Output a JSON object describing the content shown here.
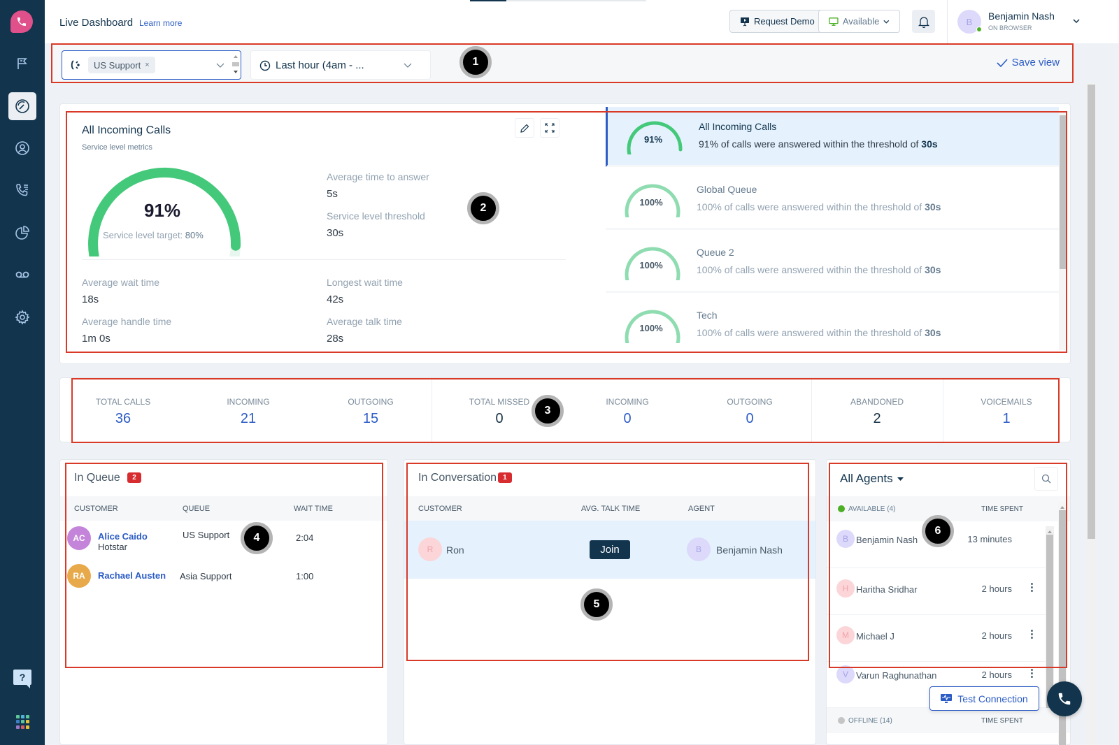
{
  "sidebar": {
    "logo": "phone-logo",
    "items": [
      {
        "name": "flag",
        "icon": "flag-icon",
        "active": false
      },
      {
        "name": "dashboard",
        "icon": "speedometer-icon",
        "active": true
      },
      {
        "name": "contacts",
        "icon": "user-circle-icon",
        "active": false
      },
      {
        "name": "call-log",
        "icon": "phone-list-icon",
        "active": false
      },
      {
        "name": "analytics",
        "icon": "pie-chart-icon",
        "active": false
      },
      {
        "name": "voicemail",
        "icon": "voicemail-icon",
        "active": false
      },
      {
        "name": "settings",
        "icon": "gear-icon",
        "active": false
      }
    ],
    "help_label": "?",
    "apps_colors": [
      "#5fc69a",
      "#4fb3d9",
      "#5fc69a",
      "#3d7fc4",
      "#5fc69a",
      "#e2c23a",
      "#9a7ac6",
      "#d65d64",
      "#e2c23a"
    ]
  },
  "header": {
    "title": "Live Dashboard",
    "learn_more": "Learn more",
    "request_demo": "Request Demo",
    "availability": "Available",
    "user": {
      "initial": "B",
      "name": "Benjamin Nash",
      "status": "ON BROWSER"
    }
  },
  "filters": {
    "queue_chip": "US Support",
    "time_range": "Last hour (4am - ...",
    "save_view": "Save view"
  },
  "markers": [
    "1",
    "2",
    "3",
    "4",
    "5",
    "6"
  ],
  "service_level": {
    "title": "All Incoming Calls",
    "subtitle": "Service level metrics",
    "gauge_value": "91%",
    "gauge_fraction": 0.91,
    "target_label": "Service level target:",
    "target_value": "80%",
    "metrics": [
      {
        "label": "Average time to answer",
        "value": "5s"
      },
      {
        "label": "Service level threshold",
        "value": "30s"
      },
      {
        "label": "Average wait time",
        "value": "18s"
      },
      {
        "label": "Longest wait time",
        "value": "42s"
      },
      {
        "label": "Average handle time",
        "value": "1m 0s"
      },
      {
        "label": "Average talk time",
        "value": "28s"
      }
    ],
    "queues": [
      {
        "name": "All Incoming Calls",
        "percent": "91%",
        "fraction": 0.91,
        "desc_prefix": "91% of calls were answered within the threshold of ",
        "threshold": "30s",
        "active": true
      },
      {
        "name": "Global Queue",
        "percent": "100%",
        "fraction": 1.0,
        "desc_prefix": "100% of calls were answered within the threshold of ",
        "threshold": "30s",
        "active": false
      },
      {
        "name": "Queue 2",
        "percent": "100%",
        "fraction": 1.0,
        "desc_prefix": "100% of calls were answered within the threshold of ",
        "threshold": "30s",
        "active": false
      },
      {
        "name": "Tech",
        "percent": "100%",
        "fraction": 1.0,
        "desc_prefix": "100% of calls were answered within the threshold of ",
        "threshold": "30s",
        "active": false
      }
    ]
  },
  "stats": [
    {
      "label": "TOTAL CALLS",
      "value": "36"
    },
    {
      "label": "INCOMING",
      "value": "21"
    },
    {
      "label": "OUTGOING",
      "value": "15"
    },
    {
      "label": "TOTAL MISSED",
      "value": "0"
    },
    {
      "label": "INCOMING",
      "value": "0"
    },
    {
      "label": "OUTGOING",
      "value": "0"
    },
    {
      "label": "ABANDONED",
      "value": "2"
    },
    {
      "label": "VOICEMAILS",
      "value": "1"
    }
  ],
  "in_queue": {
    "title": "In Queue",
    "count": "2",
    "columns": [
      "CUSTOMER",
      "QUEUE",
      "WAIT TIME"
    ],
    "rows": [
      {
        "initials": "AC",
        "avatar_color": "#c384d9",
        "name": "Alice Caido",
        "company": "Hotstar",
        "queue": "US Support",
        "wait": "2:04"
      },
      {
        "initials": "RA",
        "avatar_color": "#e8a94a",
        "name": "Rachael Austen",
        "company": "",
        "queue": "Asia Support",
        "wait": "1:00"
      }
    ]
  },
  "in_conversation": {
    "title": "In Conversation",
    "count": "1",
    "columns": [
      "CUSTOMER",
      "AVG. TALK TIME",
      "AGENT"
    ],
    "rows": [
      {
        "customer_initial": "R",
        "customer": "Ron",
        "action": "Join",
        "agent_initial": "B",
        "agent": "Benjamin Nash"
      }
    ]
  },
  "agents": {
    "filter_label": "All Agents",
    "available_label": "AVAILABLE (4)",
    "time_header": "TIME SPENT",
    "available": [
      {
        "initial": "B",
        "name": "Benjamin Nash",
        "time": "13 minutes",
        "color": "#dcd9fb",
        "text": "#a8a3e6",
        "menu": false
      },
      {
        "initial": "H",
        "name": "Haritha Sridhar",
        "time": "2 hours",
        "color": "#fbd5d8",
        "text": "#f0a4aa",
        "menu": true
      },
      {
        "initial": "M",
        "name": "Michael J",
        "time": "2 hours",
        "color": "#fbd5d8",
        "text": "#f0a4aa",
        "menu": true
      },
      {
        "initial": "V",
        "name": "Varun Raghunathan",
        "time": "2 hours",
        "color": "#dcd9fb",
        "text": "#a8a3e6",
        "menu": true
      }
    ],
    "offline_label": "OFFLINE (14)",
    "offline_time_header": "TIME SPENT"
  },
  "floating": {
    "test_connection": "Test Connection"
  }
}
